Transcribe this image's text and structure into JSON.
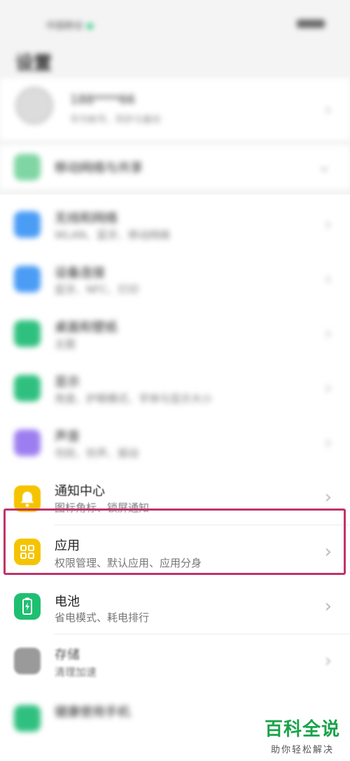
{
  "status_bar": {
    "carrier": "中国移动",
    "battery": ""
  },
  "header": {
    "title": "设置"
  },
  "account": {
    "name": "188****66",
    "subtitle": "华为帐号、同步与备份"
  },
  "hotspot": {
    "label": "移动网络与共享",
    "icon": "share-icon"
  },
  "blurred_items": [
    {
      "title": "无线和网络",
      "subtitle": "WLAN、蓝牙、移动网络"
    },
    {
      "title": "设备连接",
      "subtitle": "蓝牙、NFC、打印"
    },
    {
      "title": "桌面和壁纸",
      "subtitle": "主题"
    },
    {
      "title": "显示",
      "subtitle": "亮度、护眼模式、字体与显示大小"
    },
    {
      "title": "声音",
      "subtitle": "勿扰、铃声、振动"
    }
  ],
  "notification": {
    "title": "通知中心",
    "subtitle": "图标角标、锁屏通知",
    "icon": "bell-icon"
  },
  "apps": {
    "title": "应用",
    "subtitle": "权限管理、默认应用、应用分身",
    "icon": "apps-grid-icon"
  },
  "battery_item": {
    "title": "电池",
    "subtitle": "省电模式、耗电排行",
    "icon": "battery-icon"
  },
  "storage": {
    "title": "存储",
    "subtitle": "清理加速",
    "icon": "storage-icon"
  },
  "bottom_item": {
    "title": "健康使用手机"
  },
  "colors": {
    "highlight": "#c0336a",
    "notification_icon": "#f5c400",
    "apps_icon": "#f5c400",
    "battery_icon": "#1fbf72",
    "watermark": "#1aa34a"
  },
  "watermark": {
    "main": "百科全说",
    "sub": "助你轻松解决"
  }
}
